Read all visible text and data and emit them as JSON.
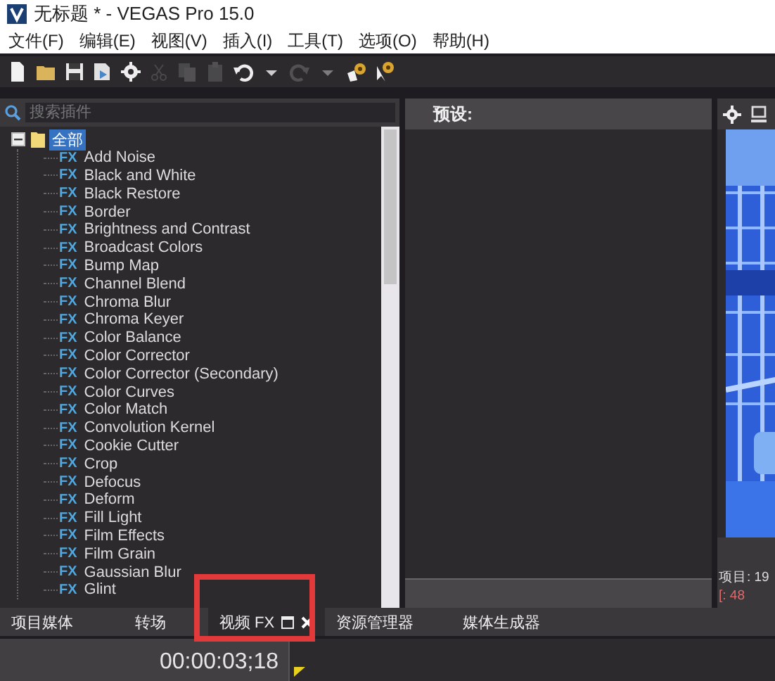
{
  "window": {
    "title": "无标题 * - VEGAS Pro 15.0"
  },
  "menu": [
    "文件(F)",
    "编辑(E)",
    "视图(V)",
    "插入(I)",
    "工具(T)",
    "选项(O)",
    "帮助(H)"
  ],
  "toolbar": [
    {
      "kind": "new",
      "disabled": false
    },
    {
      "kind": "open",
      "disabled": false
    },
    {
      "kind": "save",
      "disabled": false
    },
    {
      "kind": "render",
      "disabled": false
    },
    {
      "kind": "settings",
      "disabled": false
    },
    {
      "kind": "cut",
      "disabled": true
    },
    {
      "kind": "copy",
      "disabled": true
    },
    {
      "kind": "paste",
      "disabled": true
    },
    {
      "kind": "undo",
      "disabled": false
    },
    {
      "kind": "dropdown",
      "disabled": false
    },
    {
      "kind": "redo",
      "disabled": true
    },
    {
      "kind": "dropdown",
      "disabled": true
    },
    {
      "kind": "help",
      "disabled": false
    },
    {
      "kind": "whats-this",
      "disabled": false
    }
  ],
  "plugin_search": {
    "placeholder": "搜索插件"
  },
  "plugin_tree": {
    "label": "全部",
    "expanded": true,
    "selected": true,
    "children": [
      {
        "badge": "FX",
        "label": "Add Noise"
      },
      {
        "badge": "FX",
        "label": "Black and White"
      },
      {
        "badge": "FX",
        "label": "Black Restore"
      },
      {
        "badge": "FX",
        "label": "Border"
      },
      {
        "badge": "FX",
        "label": "Brightness and Contrast"
      },
      {
        "badge": "FX",
        "label": "Broadcast Colors"
      },
      {
        "badge": "FX",
        "label": "Bump Map"
      },
      {
        "badge": "FX",
        "label": "Channel Blend"
      },
      {
        "badge": "FX",
        "label": "Chroma Blur"
      },
      {
        "badge": "FX",
        "label": "Chroma Keyer"
      },
      {
        "badge": "FX",
        "label": "Color Balance"
      },
      {
        "badge": "FX",
        "label": "Color Corrector"
      },
      {
        "badge": "FX",
        "label": "Color Corrector (Secondary)"
      },
      {
        "badge": "FX",
        "label": "Color Curves"
      },
      {
        "badge": "FX",
        "label": "Color Match"
      },
      {
        "badge": "FX",
        "label": "Convolution Kernel"
      },
      {
        "badge": "FX",
        "label": "Cookie Cutter"
      },
      {
        "badge": "FX",
        "label": "Crop"
      },
      {
        "badge": "FX",
        "label": "Defocus"
      },
      {
        "badge": "FX",
        "label": "Deform"
      },
      {
        "badge": "FX",
        "label": "Fill Light"
      },
      {
        "badge": "FX",
        "label": "Film Effects"
      },
      {
        "badge": "FX",
        "label": "Film Grain"
      },
      {
        "badge": "FX",
        "label": "Gaussian Blur"
      },
      {
        "badge": "FX",
        "label": "Glint"
      }
    ]
  },
  "presets": {
    "label": "预设:"
  },
  "preview": {
    "kind": "picture",
    "project_info": "项目: 19",
    "frame_info": "[: 48"
  },
  "dock_tabs": [
    {
      "label": "项目媒体",
      "selected": false,
      "highlighted": false
    },
    {
      "label": "转场",
      "selected": false,
      "highlighted": false
    },
    {
      "label": "视频 FX",
      "selected": true,
      "highlighted": true
    },
    {
      "label": "资源管理器",
      "selected": false,
      "highlighted": false
    },
    {
      "label": "媒体生成器",
      "selected": false,
      "highlighted": false
    }
  ],
  "timeline": {
    "timecode": "00:00:03;18"
  }
}
